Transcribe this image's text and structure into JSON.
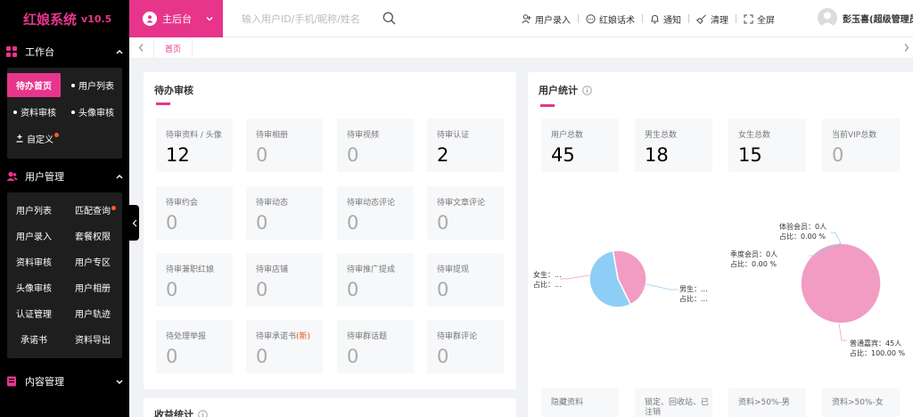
{
  "brand": {
    "title": "红娘系统",
    "version": "v10.5"
  },
  "sidebar": {
    "workbench": {
      "label": "工作台",
      "items": [
        {
          "label": "待办首页"
        },
        {
          "label": "用户列表"
        },
        {
          "label": "资料审核"
        },
        {
          "label": "头像审核"
        },
        {
          "label": "自定义"
        }
      ]
    },
    "user_mgmt": {
      "label": "用户管理",
      "items": [
        {
          "label": "用户列表"
        },
        {
          "label": "匹配查询"
        },
        {
          "label": "用户录入"
        },
        {
          "label": "套餐权限"
        },
        {
          "label": "资料审核"
        },
        {
          "label": "用户专区"
        },
        {
          "label": "头像审核"
        },
        {
          "label": "用户相册"
        },
        {
          "label": "认证管理"
        },
        {
          "label": "用户轨迹"
        },
        {
          "label": "承诺书"
        },
        {
          "label": "资料导出"
        }
      ]
    },
    "content_mgmt": {
      "label": "内容管理"
    }
  },
  "topbar": {
    "home_label": "主后台",
    "search_placeholder": "输入用户ID/手机/昵称/姓名",
    "items": [
      {
        "label": "用户录入"
      },
      {
        "label": "红娘话术"
      },
      {
        "label": "通知"
      },
      {
        "label": "清理"
      },
      {
        "label": "全屏"
      }
    ],
    "user_name": "彭玉喜(超级管理员)"
  },
  "tabs": {
    "home": "首页"
  },
  "pending": {
    "title": "待办审核",
    "tiles": [
      {
        "label": "待审资料 / 头像",
        "value": "12"
      },
      {
        "label": "待审相册",
        "value": "0"
      },
      {
        "label": "待审视频",
        "value": "0"
      },
      {
        "label": "待审认证",
        "value": "2"
      },
      {
        "label": "待审约会",
        "value": "0"
      },
      {
        "label": "待审动态",
        "value": "0"
      },
      {
        "label": "待审动态评论",
        "value": "0"
      },
      {
        "label": "待审文章评论",
        "value": "0"
      },
      {
        "label": "待审兼职红娘",
        "value": "0"
      },
      {
        "label": "待审店铺",
        "value": "0"
      },
      {
        "label": "待审推广提成",
        "value": "0"
      },
      {
        "label": "待审提现",
        "value": "0"
      },
      {
        "label": "待处理举报",
        "value": "0"
      },
      {
        "label": "待审承诺书",
        "label_hl": "(新)",
        "value": "0"
      },
      {
        "label": "待审群话题",
        "value": "0"
      },
      {
        "label": "待审群评论",
        "value": "0"
      }
    ],
    "next_title": "收益统计"
  },
  "user_stats": {
    "title": "用户统计",
    "tiles": [
      {
        "label": "用户总数",
        "value": "45"
      },
      {
        "label": "男生总数",
        "value": "18"
      },
      {
        "label": "女生总数",
        "value": "15"
      },
      {
        "label": "当前VIP总数",
        "value": "0"
      }
    ],
    "bottom_tiles": [
      {
        "label": "隐藏资料"
      },
      {
        "label": "锁定、回收站、已注销"
      },
      {
        "label": "资料>50%-男"
      },
      {
        "label": "资料>50%-女"
      }
    ]
  },
  "chart_data": [
    {
      "type": "pie",
      "labels": [
        "女生",
        "男生"
      ],
      "label_texts": [
        {
          "line1": "女生：...",
          "line2": "占比：..."
        },
        {
          "line1": "男生：...",
          "line2": "占比：..."
        }
      ],
      "values": [
        15,
        18
      ],
      "colors": [
        "#f29cc3",
        "#8ecdf5"
      ]
    },
    {
      "type": "pie",
      "labels": [
        "体验会员",
        "季度会员",
        "普通嘉宾"
      ],
      "label_texts": [
        {
          "line1": "体验会员：0人",
          "line2": "占比：0.00 %"
        },
        {
          "line1": "季度会员：0人",
          "line2": "占比：0.00 %"
        },
        {
          "line1": "普通嘉宾：45人",
          "line2": "占比：100.00 %"
        }
      ],
      "values": [
        0,
        0,
        45
      ],
      "colors": [
        "#8ecdf5",
        "#8ecdf5",
        "#f29cc3"
      ]
    }
  ],
  "colors": {
    "accent": "#e8358c",
    "sidebar_bg": "#000000",
    "highlight": "#e8551f"
  }
}
